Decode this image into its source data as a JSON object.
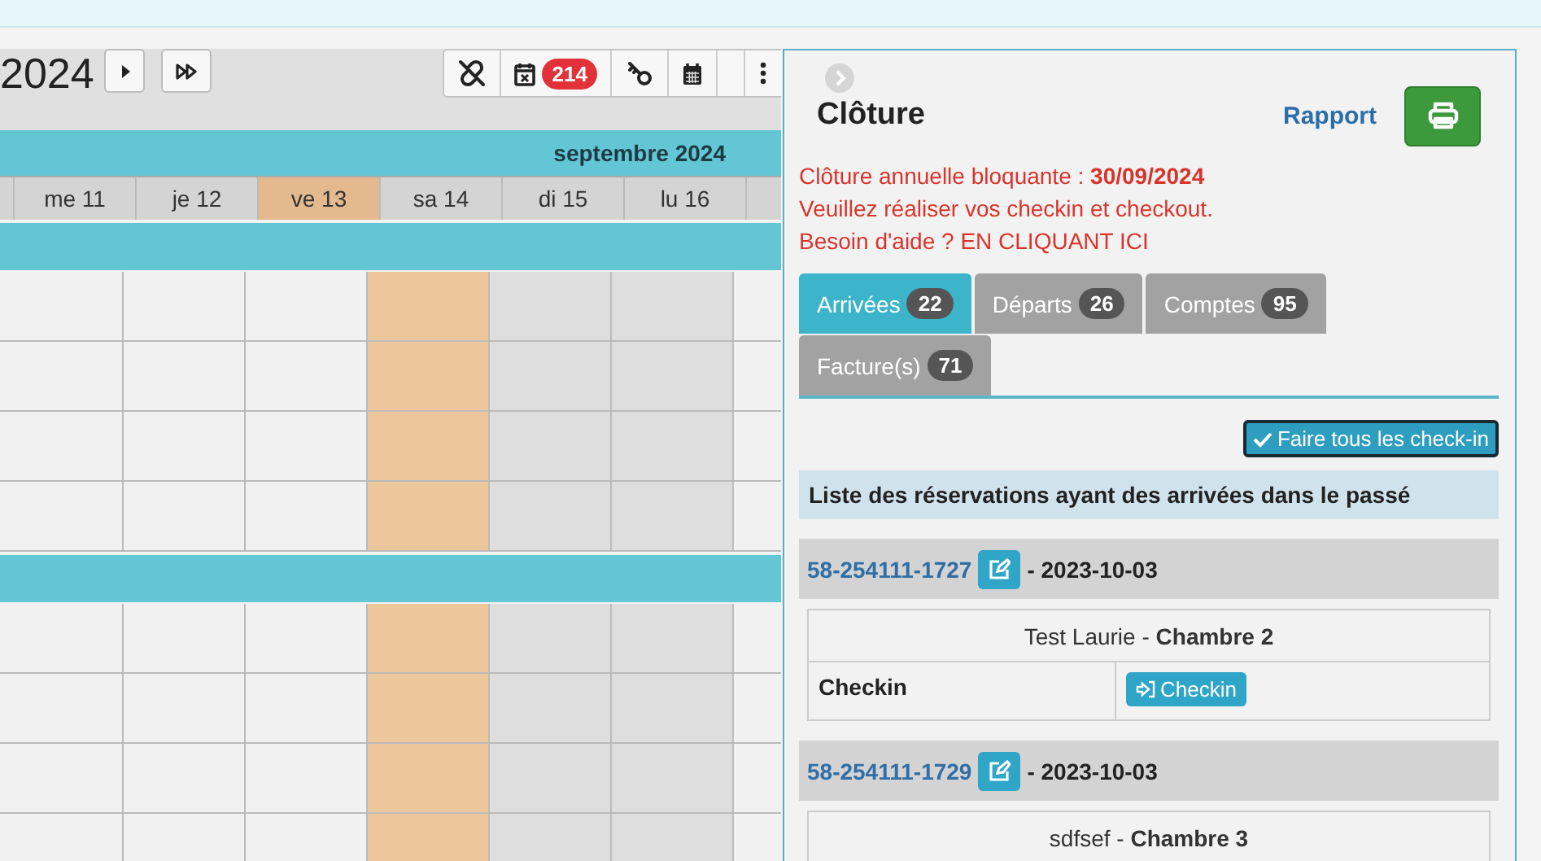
{
  "toolbar": {
    "year": "2024",
    "badge": "214"
  },
  "calendar": {
    "month": "septembre 2024",
    "days": [
      {
        "label": "me 11",
        "kind": "weekday"
      },
      {
        "label": "je 12",
        "kind": "weekday"
      },
      {
        "label": "ve 13",
        "kind": "today"
      },
      {
        "label": "sa 14",
        "kind": "weekend"
      },
      {
        "label": "di 15",
        "kind": "weekend"
      },
      {
        "label": "lu 16",
        "kind": "weekday"
      }
    ]
  },
  "panel": {
    "title": "Clôture",
    "report_link": "Rapport",
    "alerts": [
      "Clôture annuelle bloquante : **30/09/2024**",
      "Veuillez réaliser vos checkin et checkout.",
      "Besoin d'aide ? EN CLIQUANT ICI"
    ],
    "tabs": [
      {
        "label": "Arrivées",
        "count": "22",
        "selected": true
      },
      {
        "label": "Départs",
        "count": "26",
        "selected": false
      },
      {
        "label": "Comptes",
        "count": "95",
        "selected": false
      },
      {
        "label": "Facture(s)",
        "count": "71",
        "selected": false
      }
    ],
    "bulk_button": "Faire tous les check-in",
    "section_heading": "Liste des réservations ayant des arrivées dans le passé",
    "reservations": [
      {
        "ref": "58-254111-1727",
        "date": "- 2023-10-03",
        "guest": "Test Laurie - ",
        "room": "Chambre 2",
        "row_label": "Checkin",
        "action": "Checkin"
      },
      {
        "ref": "58-254111-1729",
        "date": "- 2023-10-03",
        "guest": "sdfsef - ",
        "room": "Chambre 3"
      }
    ]
  }
}
